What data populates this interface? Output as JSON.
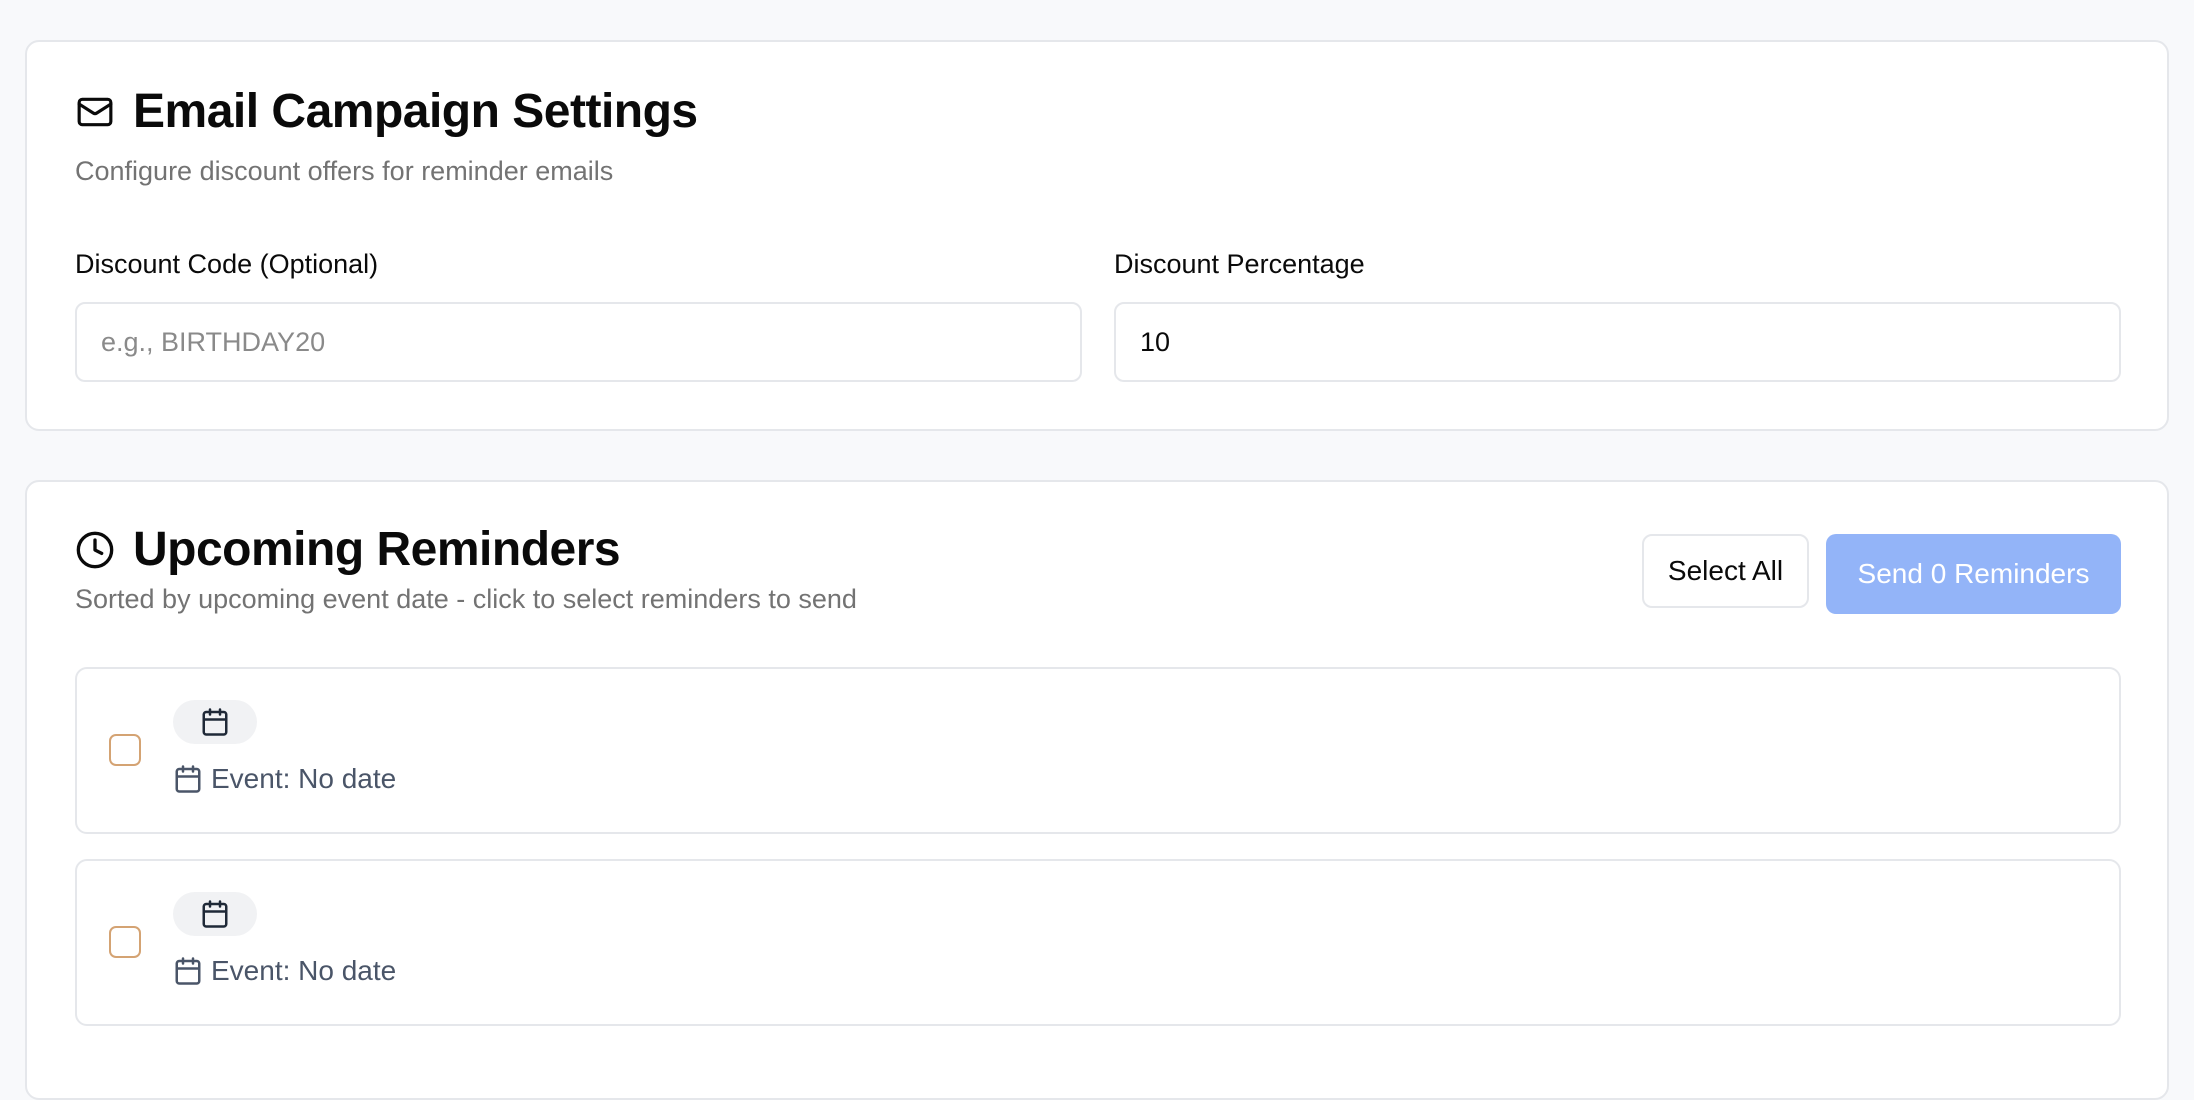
{
  "campaign": {
    "title": "Email Campaign Settings",
    "subtitle": "Configure discount offers for reminder emails",
    "title_icon": "mail-icon",
    "discount_code": {
      "label": "Discount Code (Optional)",
      "placeholder": "e.g., BIRTHDAY20",
      "value": ""
    },
    "discount_percentage": {
      "label": "Discount Percentage",
      "value": "10"
    }
  },
  "reminders": {
    "title": "Upcoming Reminders",
    "subtitle": "Sorted by upcoming event date - click to select reminders to send",
    "title_icon": "clock-icon",
    "select_all_label": "Select All",
    "send_label": "Send 0 Reminders",
    "items": [
      {
        "checked": false,
        "event_text": "Event: No date"
      },
      {
        "checked": false,
        "event_text": "Event: No date"
      }
    ]
  },
  "colors": {
    "primary_disabled": "#93b4f8",
    "checkbox_border": "#d4a373",
    "muted_text": "#737373",
    "event_text": "#4a5568"
  }
}
